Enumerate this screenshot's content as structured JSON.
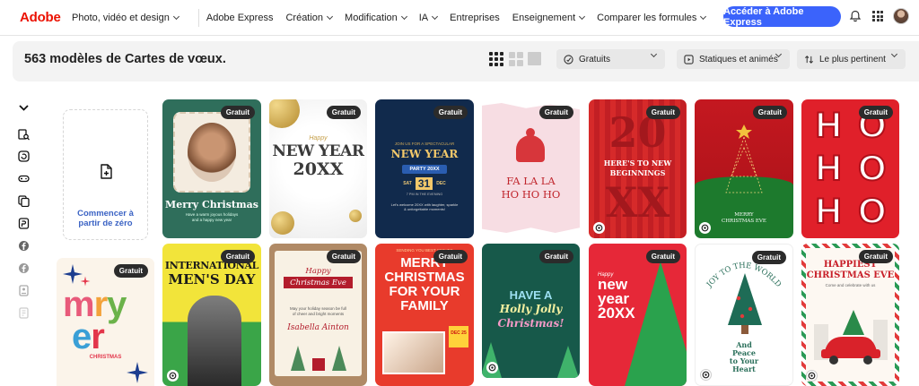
{
  "brand": {
    "logo": "Adobe",
    "accent": "#eb1000",
    "cta_color": "#3b63fb"
  },
  "nav": {
    "items": [
      {
        "label": "Photo, vidéo et design",
        "dropdown": true
      },
      {
        "label": "Adobe Express",
        "dropdown": false
      },
      {
        "label": "Création",
        "dropdown": true
      },
      {
        "label": "Modification",
        "dropdown": true
      },
      {
        "label": "IA",
        "dropdown": true
      },
      {
        "label": "Entreprises",
        "dropdown": false
      },
      {
        "label": "Enseignement",
        "dropdown": true
      },
      {
        "label": "Comparer les formules",
        "dropdown": true
      }
    ],
    "cta": "Accéder à Adobe Express"
  },
  "toolbar": {
    "title": "563 modèles de Cartes de vœux.",
    "filter_price": "Gratuits",
    "filter_type": "Statiques et animés",
    "sort": "Le plus pertinent"
  },
  "start_card": {
    "label_line1": "Commencer à",
    "label_line2": "partir de zéro"
  },
  "badge_label": "Gratuit",
  "cards": [
    {
      "title": "Merry Christmas",
      "sub": "Have a warm joyous holidays and a happy new year"
    },
    {
      "title": "NEW YEAR",
      "title2": "20XX",
      "script": "Happy"
    },
    {
      "kicker": "JOIN US FOR A SPECTACULAR",
      "title": "NEW YEAR",
      "tag": "PARTY 20XX",
      "day": "SAT",
      "date": "31",
      "month": "DEC",
      "info": "7 PM IN THE EVENING",
      "sub": "Let's welcome 20XX with laughter, sparkle & unforgettable moments!"
    },
    {
      "title": "FA LA LA",
      "title2": "HO HO HO"
    },
    {
      "big": "20",
      "big2": "XX",
      "title": "HERE'S TO NEW",
      "title2": "BEGINNINGS"
    },
    {
      "title": "MERRY",
      "title2": "CHRISTMAS EVE"
    },
    {
      "letters": [
        "H",
        "O",
        "H",
        "O",
        "H",
        "O"
      ]
    },
    {
      "title": "mery",
      "sub": "CHRISTMAS"
    },
    {
      "title": "INTERNATIONAL",
      "title2": "MEN'S DAY"
    },
    {
      "title": "Happy",
      "title2": "Christmas Eve",
      "sub": "May your holiday season be full of cheer and bright moments",
      "sign": "Isabella Ainton"
    },
    {
      "kicker": "SENDING YOU BEST WISHES",
      "title": "MERRY",
      "title2": "CHRISTMAS",
      "title3": "FOR YOUR",
      "title4": "FAMILY",
      "date": "DEC 25"
    },
    {
      "title": "HAVE A",
      "title2": "Holly Jolly",
      "title3": "Christmas!"
    },
    {
      "script": "Happy",
      "title": "new",
      "title2": "year",
      "title3": "20XX"
    },
    {
      "arc": "JOY TO THE WORLD",
      "title": "And",
      "title2": "Peace",
      "title3": "to Your",
      "title4": "Heart"
    },
    {
      "title": "HAPPIEST",
      "title2": "CHRISTMAS EVE",
      "sub": "Come and celebrate with us"
    }
  ]
}
